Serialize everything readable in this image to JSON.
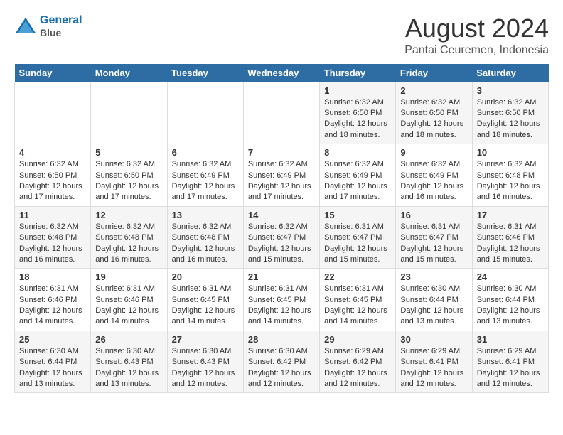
{
  "header": {
    "logo_line1": "General",
    "logo_line2": "Blue",
    "title": "August 2024",
    "subtitle": "Pantai Ceuremen, Indonesia"
  },
  "days_of_week": [
    "Sunday",
    "Monday",
    "Tuesday",
    "Wednesday",
    "Thursday",
    "Friday",
    "Saturday"
  ],
  "weeks": [
    [
      {
        "day": "",
        "detail": ""
      },
      {
        "day": "",
        "detail": ""
      },
      {
        "day": "",
        "detail": ""
      },
      {
        "day": "",
        "detail": ""
      },
      {
        "day": "1",
        "detail": "Sunrise: 6:32 AM\nSunset: 6:50 PM\nDaylight: 12 hours\nand 18 minutes."
      },
      {
        "day": "2",
        "detail": "Sunrise: 6:32 AM\nSunset: 6:50 PM\nDaylight: 12 hours\nand 18 minutes."
      },
      {
        "day": "3",
        "detail": "Sunrise: 6:32 AM\nSunset: 6:50 PM\nDaylight: 12 hours\nand 18 minutes."
      }
    ],
    [
      {
        "day": "4",
        "detail": "Sunrise: 6:32 AM\nSunset: 6:50 PM\nDaylight: 12 hours\nand 17 minutes."
      },
      {
        "day": "5",
        "detail": "Sunrise: 6:32 AM\nSunset: 6:50 PM\nDaylight: 12 hours\nand 17 minutes."
      },
      {
        "day": "6",
        "detail": "Sunrise: 6:32 AM\nSunset: 6:49 PM\nDaylight: 12 hours\nand 17 minutes."
      },
      {
        "day": "7",
        "detail": "Sunrise: 6:32 AM\nSunset: 6:49 PM\nDaylight: 12 hours\nand 17 minutes."
      },
      {
        "day": "8",
        "detail": "Sunrise: 6:32 AM\nSunset: 6:49 PM\nDaylight: 12 hours\nand 17 minutes."
      },
      {
        "day": "9",
        "detail": "Sunrise: 6:32 AM\nSunset: 6:49 PM\nDaylight: 12 hours\nand 16 minutes."
      },
      {
        "day": "10",
        "detail": "Sunrise: 6:32 AM\nSunset: 6:48 PM\nDaylight: 12 hours\nand 16 minutes."
      }
    ],
    [
      {
        "day": "11",
        "detail": "Sunrise: 6:32 AM\nSunset: 6:48 PM\nDaylight: 12 hours\nand 16 minutes."
      },
      {
        "day": "12",
        "detail": "Sunrise: 6:32 AM\nSunset: 6:48 PM\nDaylight: 12 hours\nand 16 minutes."
      },
      {
        "day": "13",
        "detail": "Sunrise: 6:32 AM\nSunset: 6:48 PM\nDaylight: 12 hours\nand 16 minutes."
      },
      {
        "day": "14",
        "detail": "Sunrise: 6:32 AM\nSunset: 6:47 PM\nDaylight: 12 hours\nand 15 minutes."
      },
      {
        "day": "15",
        "detail": "Sunrise: 6:31 AM\nSunset: 6:47 PM\nDaylight: 12 hours\nand 15 minutes."
      },
      {
        "day": "16",
        "detail": "Sunrise: 6:31 AM\nSunset: 6:47 PM\nDaylight: 12 hours\nand 15 minutes."
      },
      {
        "day": "17",
        "detail": "Sunrise: 6:31 AM\nSunset: 6:46 PM\nDaylight: 12 hours\nand 15 minutes."
      }
    ],
    [
      {
        "day": "18",
        "detail": "Sunrise: 6:31 AM\nSunset: 6:46 PM\nDaylight: 12 hours\nand 14 minutes."
      },
      {
        "day": "19",
        "detail": "Sunrise: 6:31 AM\nSunset: 6:46 PM\nDaylight: 12 hours\nand 14 minutes."
      },
      {
        "day": "20",
        "detail": "Sunrise: 6:31 AM\nSunset: 6:45 PM\nDaylight: 12 hours\nand 14 minutes."
      },
      {
        "day": "21",
        "detail": "Sunrise: 6:31 AM\nSunset: 6:45 PM\nDaylight: 12 hours\nand 14 minutes."
      },
      {
        "day": "22",
        "detail": "Sunrise: 6:31 AM\nSunset: 6:45 PM\nDaylight: 12 hours\nand 14 minutes."
      },
      {
        "day": "23",
        "detail": "Sunrise: 6:30 AM\nSunset: 6:44 PM\nDaylight: 12 hours\nand 13 minutes."
      },
      {
        "day": "24",
        "detail": "Sunrise: 6:30 AM\nSunset: 6:44 PM\nDaylight: 12 hours\nand 13 minutes."
      }
    ],
    [
      {
        "day": "25",
        "detail": "Sunrise: 6:30 AM\nSunset: 6:44 PM\nDaylight: 12 hours\nand 13 minutes."
      },
      {
        "day": "26",
        "detail": "Sunrise: 6:30 AM\nSunset: 6:43 PM\nDaylight: 12 hours\nand 13 minutes."
      },
      {
        "day": "27",
        "detail": "Sunrise: 6:30 AM\nSunset: 6:43 PM\nDaylight: 12 hours\nand 12 minutes."
      },
      {
        "day": "28",
        "detail": "Sunrise: 6:30 AM\nSunset: 6:42 PM\nDaylight: 12 hours\nand 12 minutes."
      },
      {
        "day": "29",
        "detail": "Sunrise: 6:29 AM\nSunset: 6:42 PM\nDaylight: 12 hours\nand 12 minutes."
      },
      {
        "day": "30",
        "detail": "Sunrise: 6:29 AM\nSunset: 6:41 PM\nDaylight: 12 hours\nand 12 minutes."
      },
      {
        "day": "31",
        "detail": "Sunrise: 6:29 AM\nSunset: 6:41 PM\nDaylight: 12 hours\nand 12 minutes."
      }
    ]
  ]
}
